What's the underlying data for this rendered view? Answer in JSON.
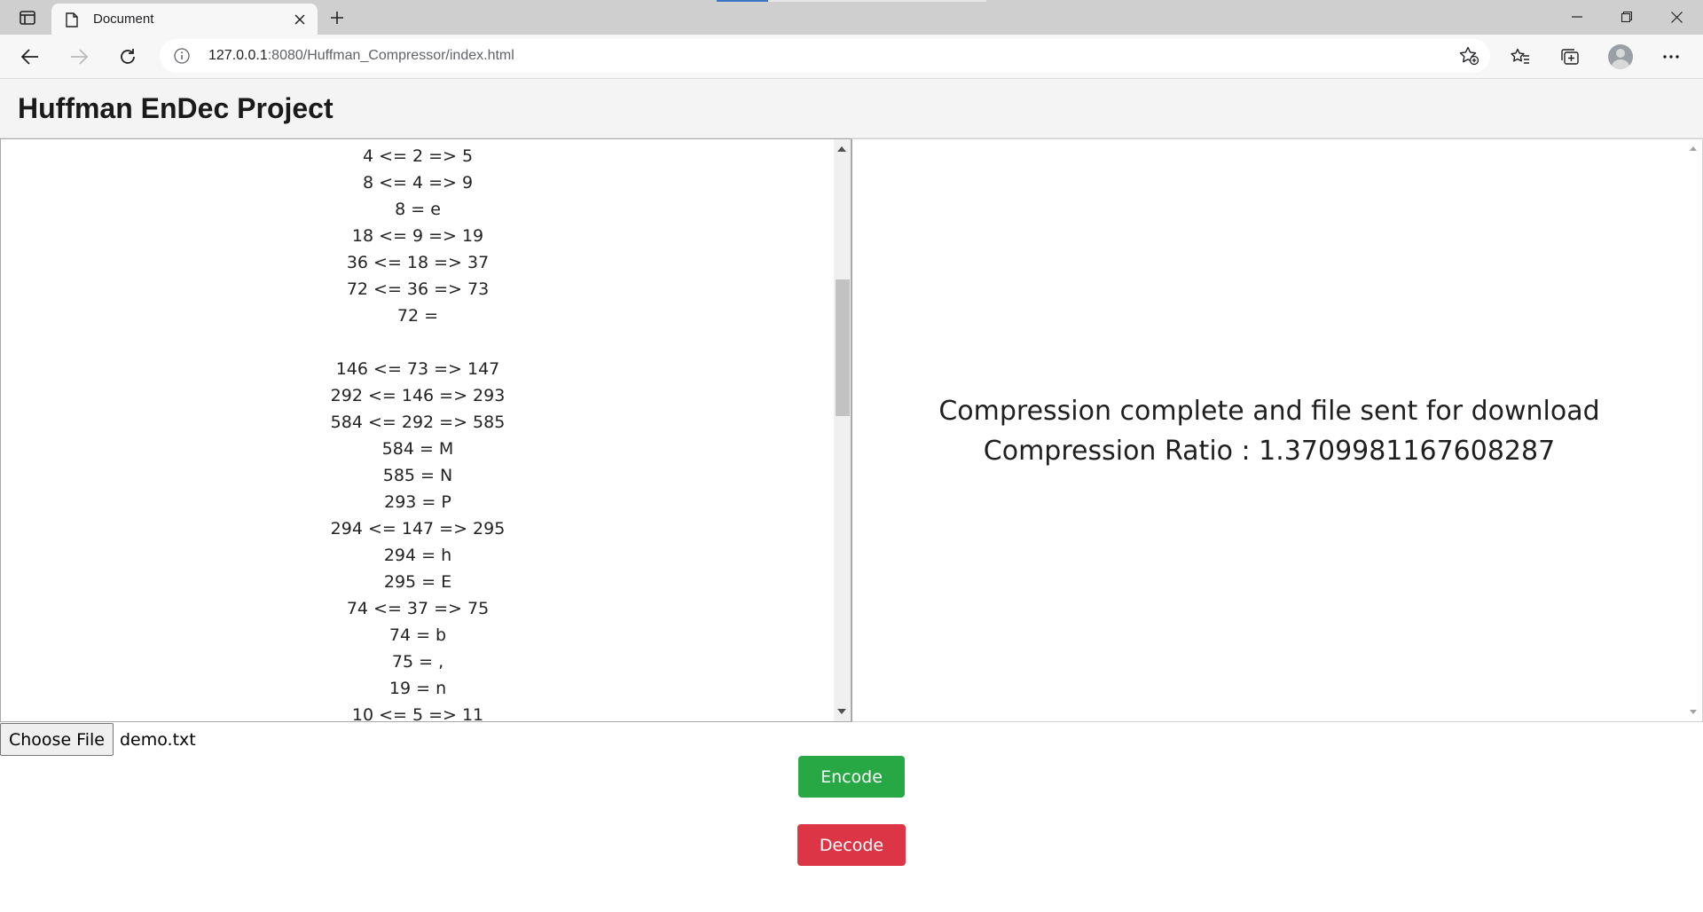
{
  "browser": {
    "tab_title": "Document",
    "url_host": "127.0.0.1",
    "url_rest": ":8080/Huffman_Compressor/index.html"
  },
  "page": {
    "title": "Huffman EnDec Project"
  },
  "tree_output": [
    "4 <= 2 => 5",
    "8 <= 4 => 9",
    "8 = e",
    "18 <= 9 => 19",
    "36 <= 18 => 37",
    "72 <= 36 => 73",
    "72 =",
    "",
    "146 <= 73 => 147",
    "292 <= 146 => 293",
    "584 <= 292 => 585",
    "584 = M",
    "585 = N",
    "293 = P",
    "294 <= 147 => 295",
    "294 = h",
    "295 = E",
    "74 <= 37 => 75",
    "74 = b",
    "75 = ,",
    "19 = n",
    "10 <= 5 => 11"
  ],
  "status": {
    "line1": "Compression complete and file sent for download",
    "line2": "Compression Ratio : 1.3709981167608287"
  },
  "file_input": {
    "button_label": "Choose File",
    "file_name": "demo.txt"
  },
  "actions": {
    "encode_label": "Encode",
    "decode_label": "Decode"
  },
  "colors": {
    "encode": "#28a745",
    "decode": "#dc3545"
  }
}
